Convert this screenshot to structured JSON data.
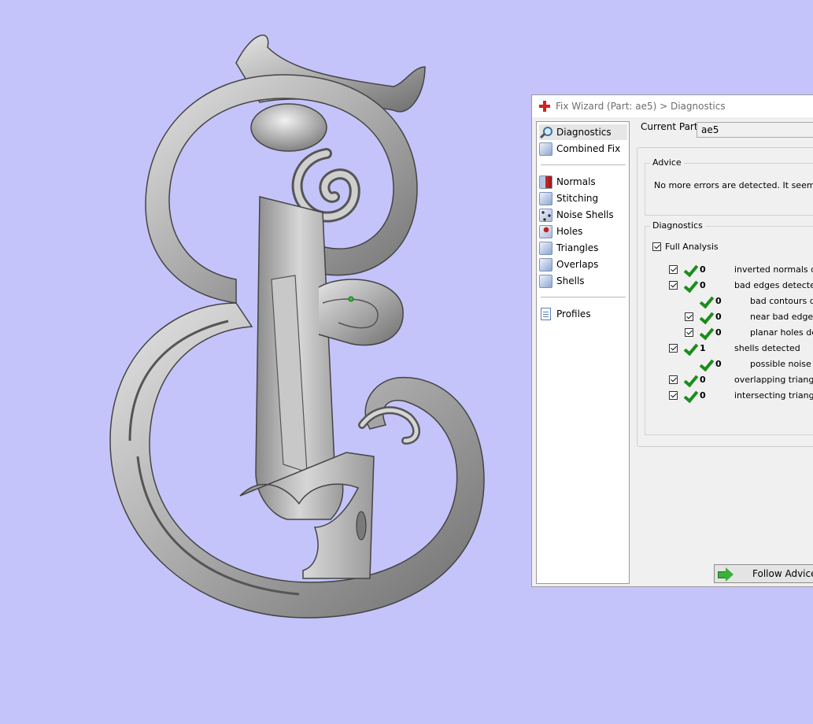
{
  "dialog": {
    "title": "Fix Wizard (Part: ae5) > Diagnostics",
    "nav": [
      {
        "label": "Diagnostics",
        "icon": "magnifier-icon",
        "selected": true
      },
      {
        "label": "Combined Fix",
        "icon": "cube-icon"
      },
      {
        "label": "Normals",
        "icon": "normals-cube-icon"
      },
      {
        "label": "Stitching",
        "icon": "stitching-cube-icon"
      },
      {
        "label": "Noise Shells",
        "icon": "noise-shells-cube-icon"
      },
      {
        "label": "Holes",
        "icon": "holes-cube-icon"
      },
      {
        "label": "Triangles",
        "icon": "triangles-cube-icon"
      },
      {
        "label": "Overlaps",
        "icon": "overlaps-cube-icon"
      },
      {
        "label": "Shells",
        "icon": "shells-cube-icon"
      },
      {
        "label": "Profiles",
        "icon": "document-icon"
      }
    ],
    "current_part_label": "Current Part:",
    "current_part_value": "ae5",
    "advice": {
      "label": "Advice",
      "text": "No more errors are detected. It seems tha"
    },
    "diagnostics": {
      "label": "Diagnostics",
      "full_analysis_label": "Full Analysis",
      "rows": [
        {
          "count": "0",
          "label": "inverted normals det"
        },
        {
          "count": "0",
          "label": "bad edges detected"
        },
        {
          "count": "0",
          "label": "bad contours de"
        },
        {
          "count": "0",
          "label": "near bad edges d"
        },
        {
          "count": "0",
          "label": "planar holes dete"
        },
        {
          "count": "1",
          "label": "shells detected"
        },
        {
          "count": "0",
          "label": "possible noise sh"
        },
        {
          "count": "0",
          "label": "overlapping triangles"
        },
        {
          "count": "0",
          "label": "intersecting triangles"
        }
      ]
    },
    "follow_advice_label": "Follow Advice"
  },
  "colors": {
    "viewport_background": "#c4c4fa",
    "model_gray": "#a9a9a9",
    "check_green": "#1c8c1c"
  }
}
